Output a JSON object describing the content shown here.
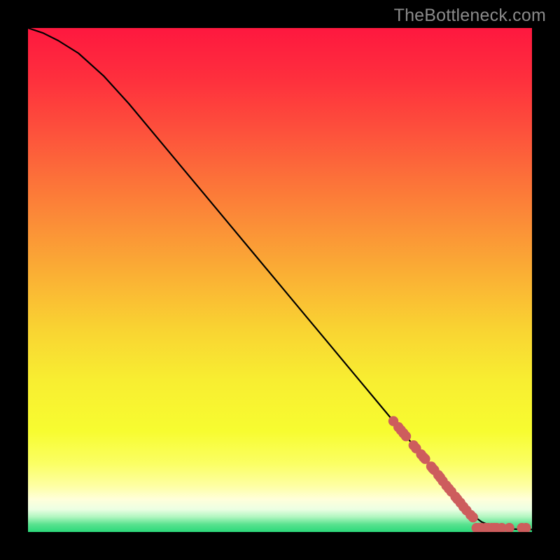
{
  "watermark": "TheBottleneck.com",
  "chart_data": {
    "type": "line",
    "title": "",
    "xlabel": "",
    "ylabel": "",
    "xlim": [
      0,
      100
    ],
    "ylim": [
      0,
      100
    ],
    "grid": false,
    "series": [
      {
        "name": "curve",
        "color": "#000000",
        "x": [
          0,
          3,
          6,
          10,
          15,
          20,
          25,
          30,
          35,
          40,
          45,
          50,
          55,
          60,
          65,
          70,
          75,
          80,
          83,
          86,
          88,
          90,
          92,
          94,
          96,
          98,
          100
        ],
        "y": [
          100,
          99,
          97.5,
          95,
          90.5,
          85,
          79,
          73,
          67,
          61,
          55,
          49,
          43,
          37,
          31,
          25,
          19,
          13,
          9,
          5.5,
          3.5,
          2,
          1.2,
          0.8,
          0.6,
          0.5,
          0.5
        ]
      },
      {
        "name": "markers",
        "color": "#cd5d5d",
        "type": "scatter",
        "points": [
          {
            "x": 72.5,
            "y": 22.0
          },
          {
            "x": 73.5,
            "y": 20.8
          },
          {
            "x": 74.0,
            "y": 20.2
          },
          {
            "x": 74.5,
            "y": 19.6
          },
          {
            "x": 75.0,
            "y": 19.0
          },
          {
            "x": 76.5,
            "y": 17.2
          },
          {
            "x": 77.0,
            "y": 16.6
          },
          {
            "x": 78.0,
            "y": 15.4
          },
          {
            "x": 78.5,
            "y": 14.8
          },
          {
            "x": 78.8,
            "y": 14.5
          },
          {
            "x": 80.0,
            "y": 13.0
          },
          {
            "x": 80.3,
            "y": 12.6
          },
          {
            "x": 80.6,
            "y": 12.3
          },
          {
            "x": 81.4,
            "y": 11.3
          },
          {
            "x": 81.8,
            "y": 10.8
          },
          {
            "x": 82.3,
            "y": 10.1
          },
          {
            "x": 83.0,
            "y": 9.2
          },
          {
            "x": 83.5,
            "y": 8.6
          },
          {
            "x": 84.0,
            "y": 8.0
          },
          {
            "x": 84.8,
            "y": 7.0
          },
          {
            "x": 85.2,
            "y": 6.5
          },
          {
            "x": 85.8,
            "y": 5.8
          },
          {
            "x": 86.4,
            "y": 5.0
          },
          {
            "x": 87.0,
            "y": 4.3
          },
          {
            "x": 87.8,
            "y": 3.4
          },
          {
            "x": 88.3,
            "y": 2.9
          },
          {
            "x": 89.0,
            "y": 0.8
          },
          {
            "x": 89.5,
            "y": 0.8
          },
          {
            "x": 90.0,
            "y": 0.8
          },
          {
            "x": 90.8,
            "y": 0.8
          },
          {
            "x": 91.3,
            "y": 0.8
          },
          {
            "x": 92.0,
            "y": 0.8
          },
          {
            "x": 92.5,
            "y": 0.8
          },
          {
            "x": 93.0,
            "y": 0.8
          },
          {
            "x": 94.0,
            "y": 0.8
          },
          {
            "x": 95.5,
            "y": 0.8
          },
          {
            "x": 98.0,
            "y": 0.8
          },
          {
            "x": 98.8,
            "y": 0.8
          }
        ]
      }
    ],
    "gradient_stops": [
      {
        "offset": 0.0,
        "color": "#fe183f"
      },
      {
        "offset": 0.1,
        "color": "#fe2f3d"
      },
      {
        "offset": 0.2,
        "color": "#fd4f3c"
      },
      {
        "offset": 0.3,
        "color": "#fc7139"
      },
      {
        "offset": 0.4,
        "color": "#fb9237"
      },
      {
        "offset": 0.5,
        "color": "#fab334"
      },
      {
        "offset": 0.6,
        "color": "#f9d432"
      },
      {
        "offset": 0.7,
        "color": "#f8ee31"
      },
      {
        "offset": 0.8,
        "color": "#f7fc30"
      },
      {
        "offset": 0.865,
        "color": "#fbff64"
      },
      {
        "offset": 0.91,
        "color": "#feffa6"
      },
      {
        "offset": 0.935,
        "color": "#ffffda"
      },
      {
        "offset": 0.955,
        "color": "#ecffe3"
      },
      {
        "offset": 0.97,
        "color": "#b1f6c0"
      },
      {
        "offset": 0.985,
        "color": "#58e28f"
      },
      {
        "offset": 1.0,
        "color": "#2cd97a"
      }
    ]
  }
}
